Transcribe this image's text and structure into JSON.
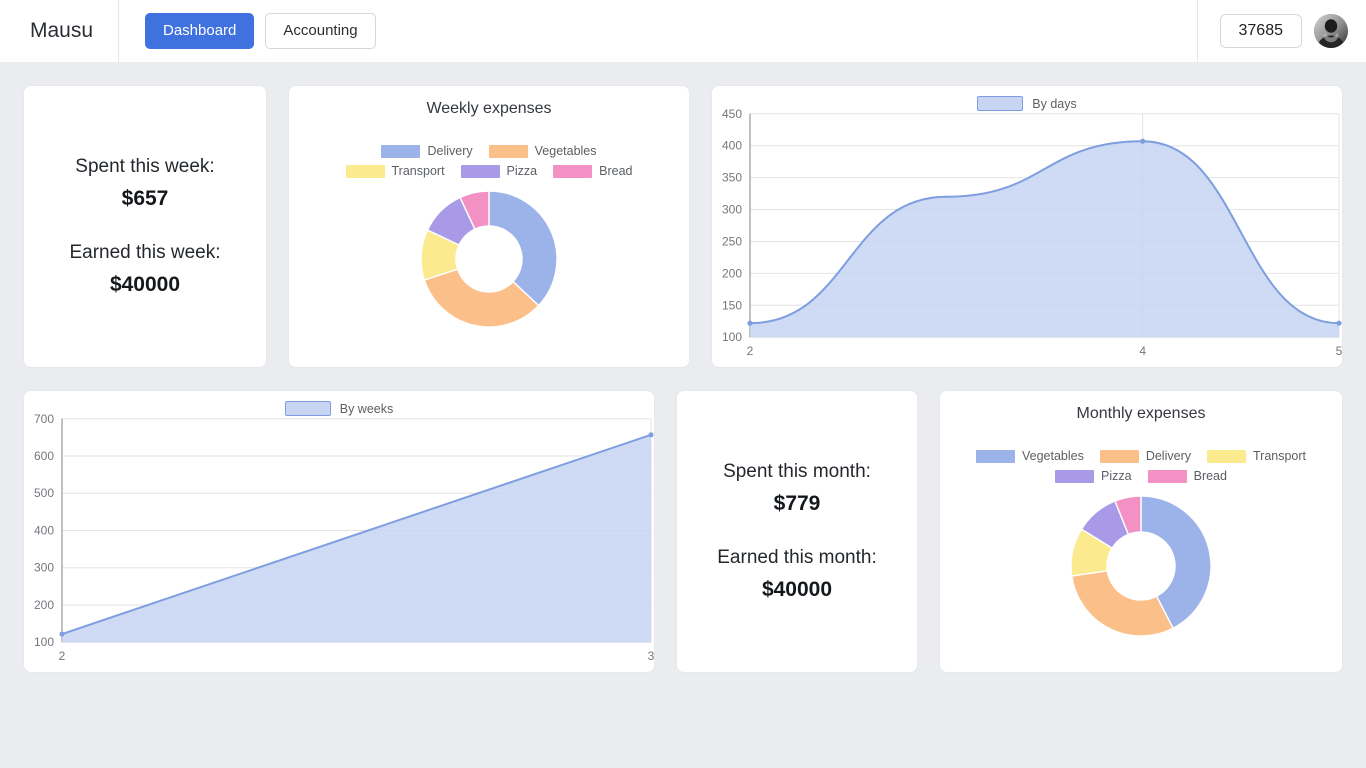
{
  "header": {
    "brand": "Mausu",
    "tabs": [
      {
        "label": "Dashboard",
        "active": true
      },
      {
        "label": "Accounting",
        "active": false
      }
    ],
    "counter": "37685",
    "avatar_name": "user-avatar"
  },
  "colors": {
    "accent": "#3f72df",
    "background": "#eaecef",
    "card": "#ffffff",
    "line_stroke": "#7e9ee0",
    "area_fill": "#c7d5f2",
    "grid": "#e2e4e6",
    "palette": {
      "blue": "#9bb3e8",
      "orange": "#fbc08a",
      "yellow": "#fbea8e",
      "purple": "#a99ae8",
      "pink": "#f391c4"
    }
  },
  "cards": {
    "week_stats": {
      "spent_label": "Spent this week:",
      "spent_value": "$657",
      "earned_label": "Earned this week:",
      "earned_value": "$40000"
    },
    "month_stats": {
      "spent_label": "Spent this month:",
      "spent_value": "$779",
      "earned_label": "Earned this month:",
      "earned_value": "$40000"
    }
  },
  "chart_data": [
    {
      "id": "weekly_expenses",
      "type": "pie",
      "title": "Weekly expenses",
      "legend_position": "top",
      "labels": [
        "Delivery",
        "Vegetables",
        "Transport",
        "Pizza",
        "Bread"
      ],
      "values": [
        37,
        33,
        12,
        11,
        7
      ],
      "colors": [
        "#9bb3e8",
        "#fbc08a",
        "#fbea8e",
        "#a99ae8",
        "#f391c4"
      ]
    },
    {
      "id": "by_days",
      "type": "area",
      "title": "",
      "legend": [
        "By days"
      ],
      "legend_position": "top",
      "xlabel": "",
      "ylabel": "",
      "x": [
        2,
        3,
        4,
        5
      ],
      "xticks": [
        "2",
        "4",
        "5"
      ],
      "yticks": [
        "100",
        "150",
        "200",
        "250",
        "300",
        "350",
        "400",
        "450"
      ],
      "values": [
        122,
        320,
        407,
        122
      ],
      "xlim": [
        2,
        5
      ],
      "ylim": [
        100,
        450
      ],
      "grid": true,
      "markers": [
        {
          "x": 2,
          "y": 122
        },
        {
          "x": 4,
          "y": 407
        },
        {
          "x": 5,
          "y": 122
        }
      ]
    },
    {
      "id": "by_weeks",
      "type": "area",
      "title": "",
      "legend": [
        "By weeks"
      ],
      "legend_position": "top",
      "xlabel": "",
      "ylabel": "",
      "x": [
        2,
        3
      ],
      "xticks": [
        "2",
        "3"
      ],
      "yticks": [
        "100",
        "200",
        "300",
        "400",
        "500",
        "600",
        "700"
      ],
      "values": [
        122,
        657
      ],
      "xlim": [
        2,
        3
      ],
      "ylim": [
        100,
        700
      ],
      "grid": true,
      "markers": [
        {
          "x": 2,
          "y": 122
        },
        {
          "x": 3,
          "y": 657
        }
      ]
    },
    {
      "id": "monthly_expenses",
      "type": "pie",
      "title": "Monthly expenses",
      "legend_position": "top",
      "labels": [
        "Vegetables",
        "Delivery",
        "Transport",
        "Pizza",
        "Bread"
      ],
      "values": [
        42,
        30,
        11,
        10,
        6
      ],
      "colors": [
        "#9bb3e8",
        "#fbc08a",
        "#fbea8e",
        "#a99ae8",
        "#f391c4"
      ]
    }
  ]
}
